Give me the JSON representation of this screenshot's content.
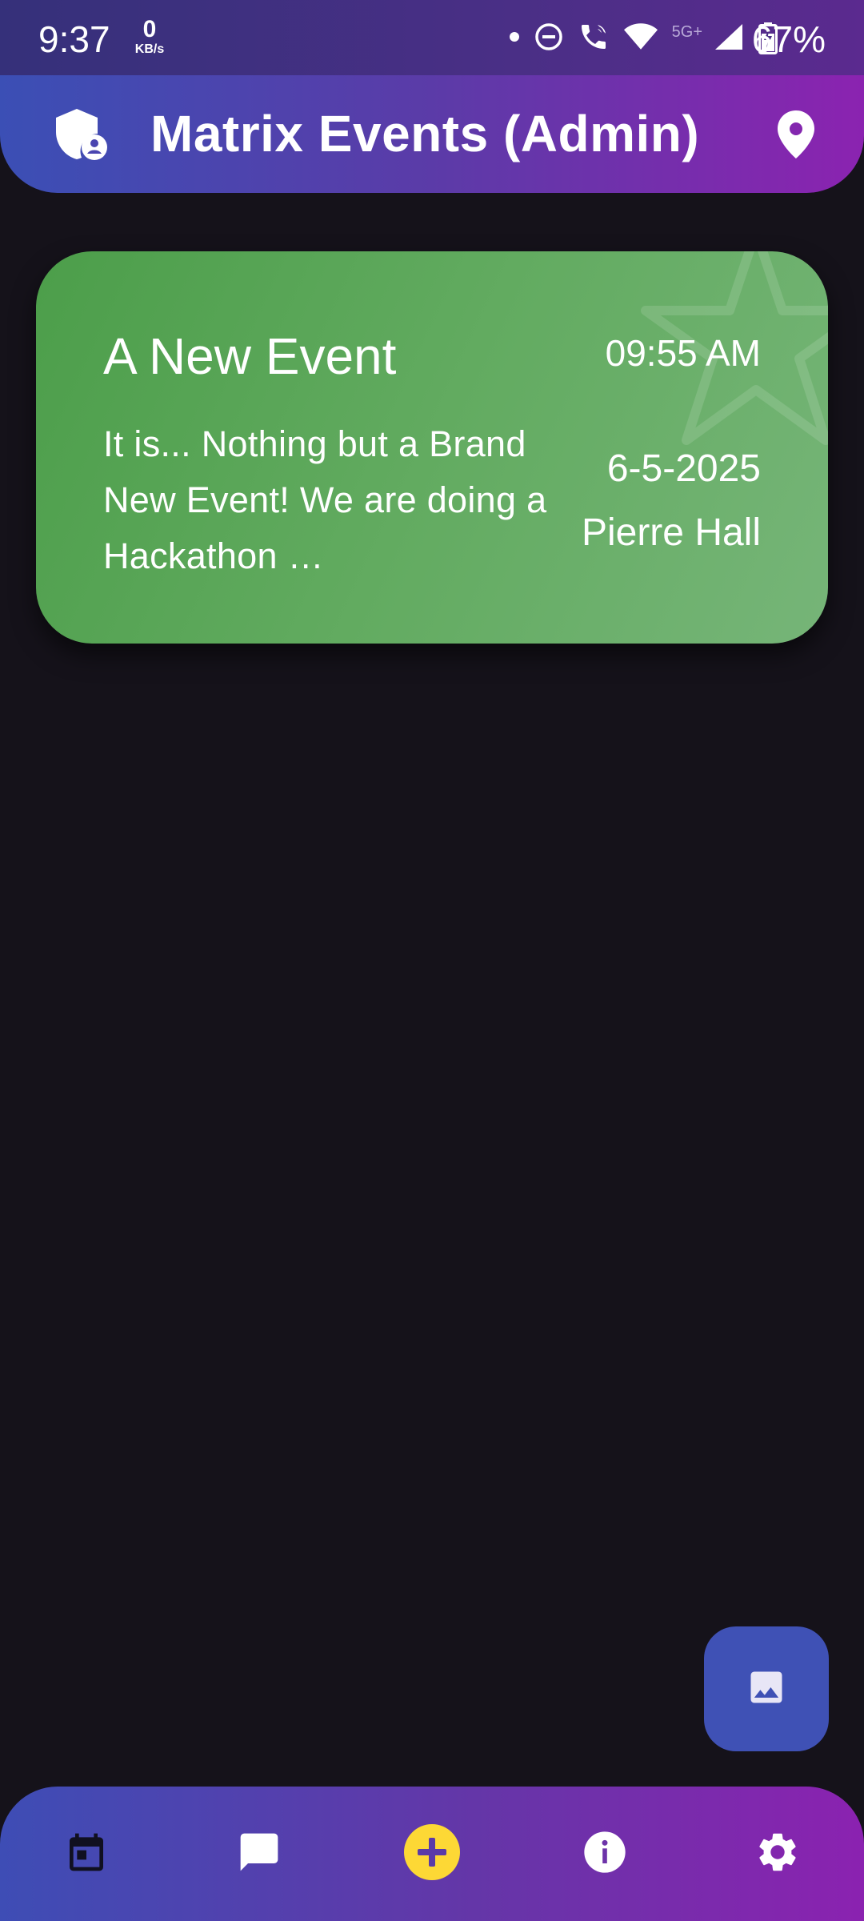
{
  "status_bar": {
    "time": "9:37",
    "net_speed_value": "0",
    "net_speed_unit": "KB/s",
    "network_type": "5G+",
    "battery_percent": "67%"
  },
  "app_bar": {
    "title": "Matrix Events (Admin)",
    "left_icon": "admin-shield-icon",
    "right_icon": "location-pin-icon"
  },
  "events": [
    {
      "title": "A New Event",
      "description": "It is...  Nothing but a Brand New Event! We are doing a Hackathon …",
      "time": "09:55 AM",
      "date": "6-5-2025",
      "location": "Pierre Hall"
    }
  ],
  "fab": {
    "icon": "image-icon"
  },
  "bottom_nav": {
    "items": [
      {
        "icon": "calendar-icon",
        "selected": true
      },
      {
        "icon": "chat-icon"
      },
      {
        "icon": "add-circle-icon",
        "highlight": "#fdd835"
      },
      {
        "icon": "info-icon"
      },
      {
        "icon": "settings-icon"
      }
    ]
  },
  "colors": {
    "background": "#15121a",
    "card_green": "#5ea95c",
    "fab": "#3f51b5",
    "accent_yellow": "#fdd835",
    "gradient_start": "#3b4fb5",
    "gradient_end": "#8b23b0"
  }
}
